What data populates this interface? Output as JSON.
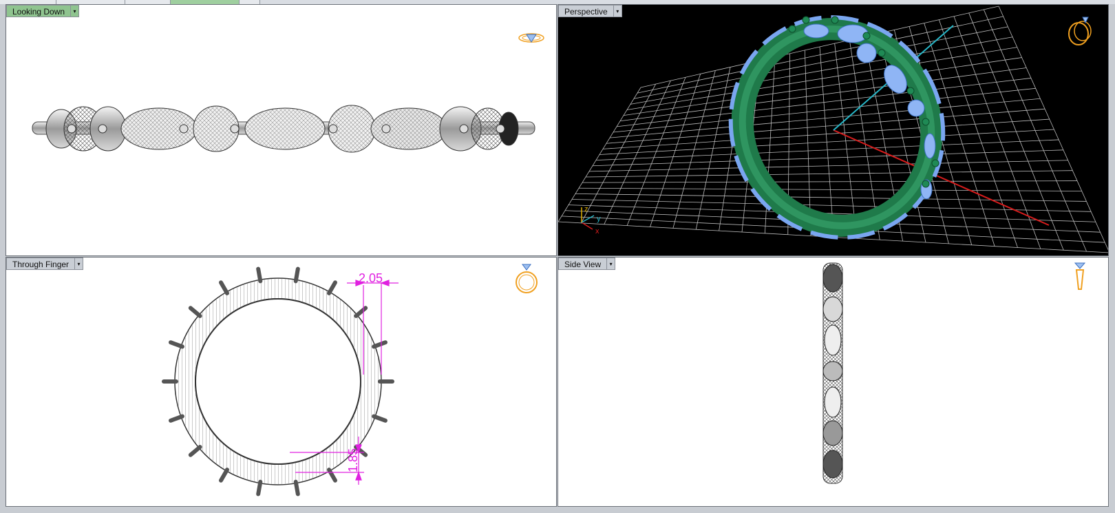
{
  "viewports": {
    "top_left": {
      "label": "Looking Down",
      "active": true
    },
    "top_right": {
      "label": "Perspective",
      "active": false
    },
    "bottom_left": {
      "label": "Through Finger",
      "active": false
    },
    "bottom_right": {
      "label": "Side View",
      "active": false
    }
  },
  "dimensions": {
    "width_value": "2.05",
    "height_value": "1.85"
  },
  "axis_labels": {
    "x": "x",
    "y": "y",
    "z": "z"
  },
  "dropdown_glyph": "▾",
  "colors": {
    "active_tab": "#8fc48f",
    "inactive_tab": "#c9ced5",
    "dimension": "#e020e0",
    "gizmo_orange": "#f0a020",
    "gem_blue": "#7aa6f0",
    "metal_green": "#1f7a4a",
    "grid_line": "#bfbfbf",
    "axis_red": "#d81c1c",
    "axis_cyan": "#27b7c8"
  }
}
